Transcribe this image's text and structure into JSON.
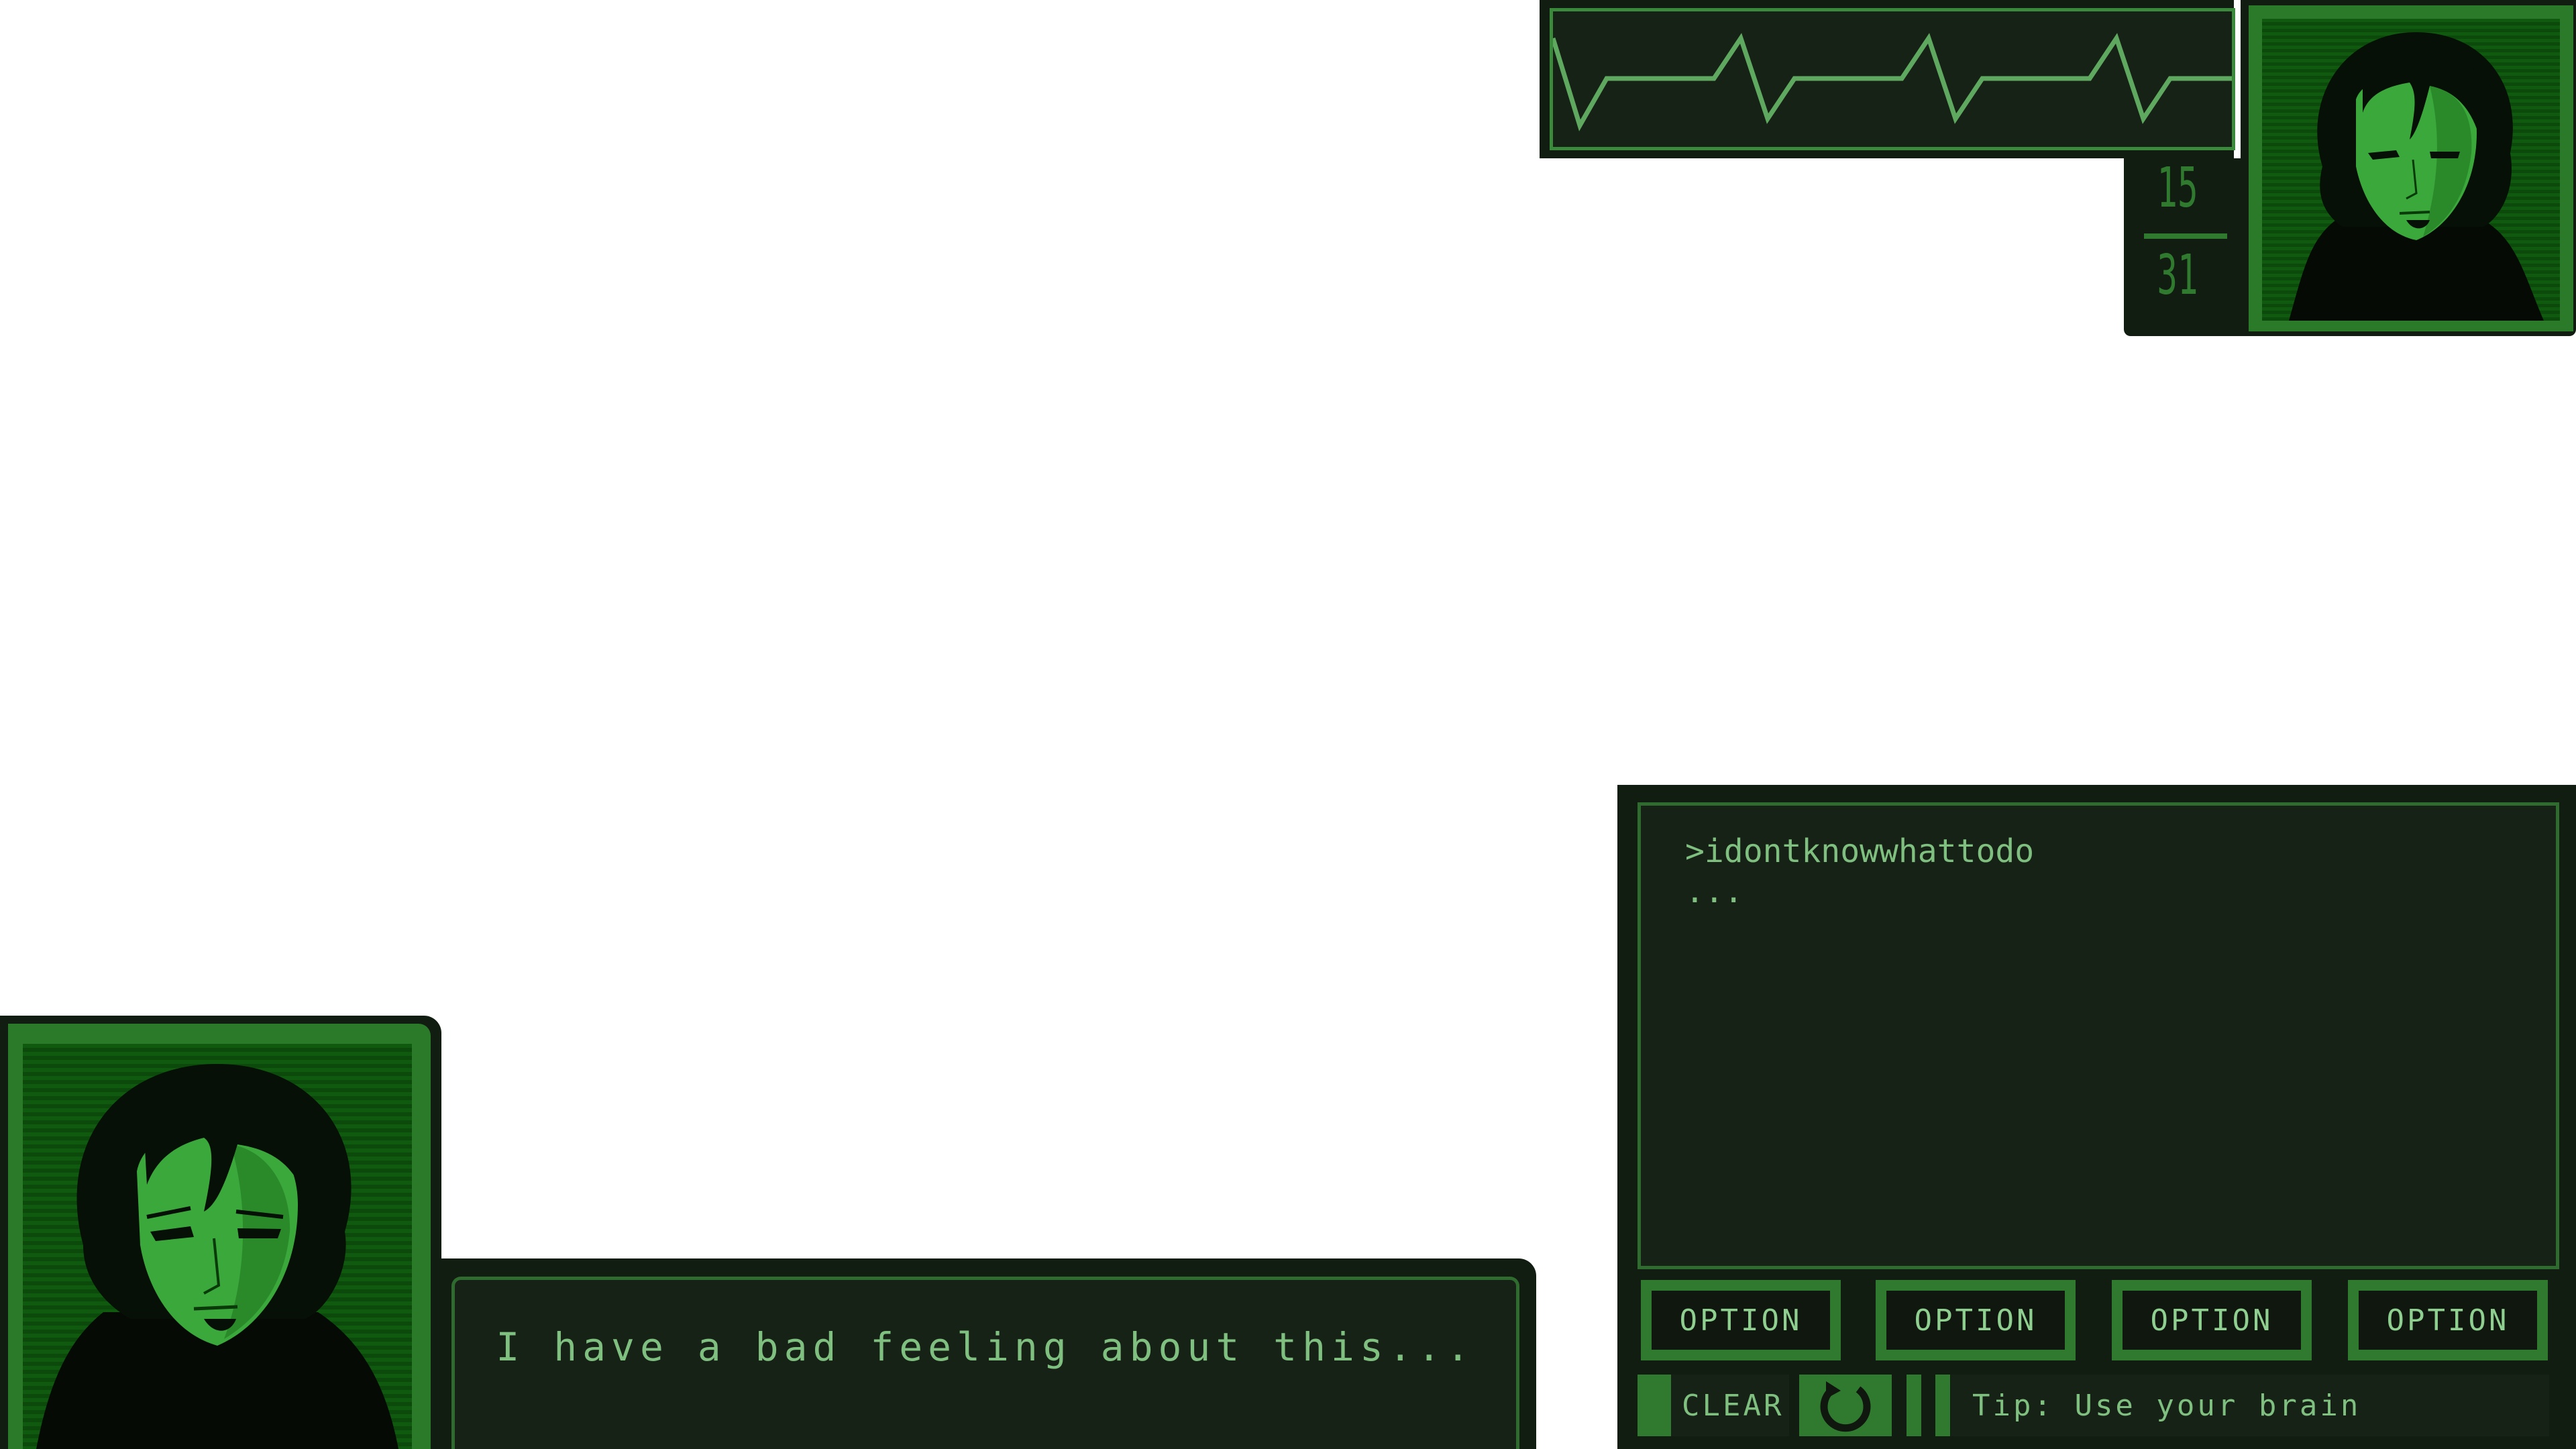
{
  "monitor": {
    "heartbeat_icon": "heartbeat-line"
  },
  "counter": {
    "current": "15",
    "total": "31"
  },
  "top_portrait": {
    "icon": "character-portrait"
  },
  "left_portrait": {
    "icon": "character-portrait"
  },
  "dialogue": {
    "text": "I have a bad feeling about this..."
  },
  "terminal": {
    "lines": [
      ">idontknowwhattodo",
      "..."
    ]
  },
  "options": [
    {
      "label": "OPTION"
    },
    {
      "label": "OPTION"
    },
    {
      "label": "OPTION"
    },
    {
      "label": "OPTION"
    }
  ],
  "controls": {
    "clear_label": "CLEAR",
    "refresh_icon": "refresh-icon",
    "tip": "Tip: Use your brain"
  },
  "colors": {
    "frame": "#121d12",
    "panel": "#172217",
    "accent": "#2f7a2f",
    "text": "#7fbf7f"
  }
}
